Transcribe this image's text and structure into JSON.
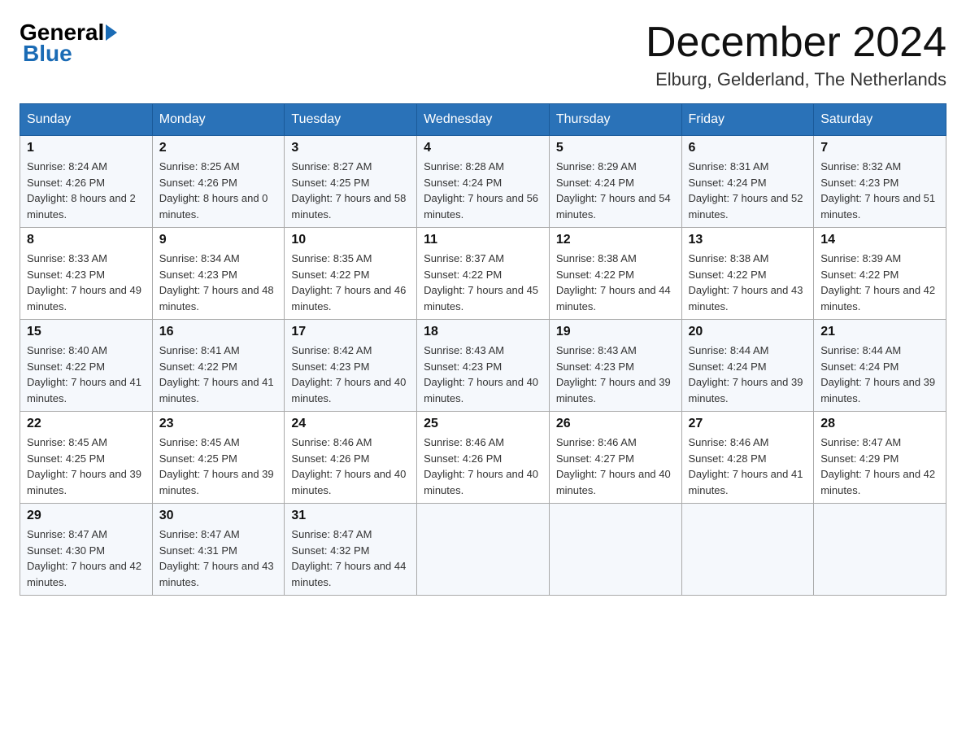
{
  "logo": {
    "general": "General",
    "blue": "Blue"
  },
  "header": {
    "month": "December 2024",
    "location": "Elburg, Gelderland, The Netherlands"
  },
  "days_of_week": [
    "Sunday",
    "Monday",
    "Tuesday",
    "Wednesday",
    "Thursday",
    "Friday",
    "Saturday"
  ],
  "weeks": [
    [
      {
        "day": "1",
        "sunrise": "8:24 AM",
        "sunset": "4:26 PM",
        "daylight": "8 hours and 2 minutes."
      },
      {
        "day": "2",
        "sunrise": "8:25 AM",
        "sunset": "4:26 PM",
        "daylight": "8 hours and 0 minutes."
      },
      {
        "day": "3",
        "sunrise": "8:27 AM",
        "sunset": "4:25 PM",
        "daylight": "7 hours and 58 minutes."
      },
      {
        "day": "4",
        "sunrise": "8:28 AM",
        "sunset": "4:24 PM",
        "daylight": "7 hours and 56 minutes."
      },
      {
        "day": "5",
        "sunrise": "8:29 AM",
        "sunset": "4:24 PM",
        "daylight": "7 hours and 54 minutes."
      },
      {
        "day": "6",
        "sunrise": "8:31 AM",
        "sunset": "4:24 PM",
        "daylight": "7 hours and 52 minutes."
      },
      {
        "day": "7",
        "sunrise": "8:32 AM",
        "sunset": "4:23 PM",
        "daylight": "7 hours and 51 minutes."
      }
    ],
    [
      {
        "day": "8",
        "sunrise": "8:33 AM",
        "sunset": "4:23 PM",
        "daylight": "7 hours and 49 minutes."
      },
      {
        "day": "9",
        "sunrise": "8:34 AM",
        "sunset": "4:23 PM",
        "daylight": "7 hours and 48 minutes."
      },
      {
        "day": "10",
        "sunrise": "8:35 AM",
        "sunset": "4:22 PM",
        "daylight": "7 hours and 46 minutes."
      },
      {
        "day": "11",
        "sunrise": "8:37 AM",
        "sunset": "4:22 PM",
        "daylight": "7 hours and 45 minutes."
      },
      {
        "day": "12",
        "sunrise": "8:38 AM",
        "sunset": "4:22 PM",
        "daylight": "7 hours and 44 minutes."
      },
      {
        "day": "13",
        "sunrise": "8:38 AM",
        "sunset": "4:22 PM",
        "daylight": "7 hours and 43 minutes."
      },
      {
        "day": "14",
        "sunrise": "8:39 AM",
        "sunset": "4:22 PM",
        "daylight": "7 hours and 42 minutes."
      }
    ],
    [
      {
        "day": "15",
        "sunrise": "8:40 AM",
        "sunset": "4:22 PM",
        "daylight": "7 hours and 41 minutes."
      },
      {
        "day": "16",
        "sunrise": "8:41 AM",
        "sunset": "4:22 PM",
        "daylight": "7 hours and 41 minutes."
      },
      {
        "day": "17",
        "sunrise": "8:42 AM",
        "sunset": "4:23 PM",
        "daylight": "7 hours and 40 minutes."
      },
      {
        "day": "18",
        "sunrise": "8:43 AM",
        "sunset": "4:23 PM",
        "daylight": "7 hours and 40 minutes."
      },
      {
        "day": "19",
        "sunrise": "8:43 AM",
        "sunset": "4:23 PM",
        "daylight": "7 hours and 39 minutes."
      },
      {
        "day": "20",
        "sunrise": "8:44 AM",
        "sunset": "4:24 PM",
        "daylight": "7 hours and 39 minutes."
      },
      {
        "day": "21",
        "sunrise": "8:44 AM",
        "sunset": "4:24 PM",
        "daylight": "7 hours and 39 minutes."
      }
    ],
    [
      {
        "day": "22",
        "sunrise": "8:45 AM",
        "sunset": "4:25 PM",
        "daylight": "7 hours and 39 minutes."
      },
      {
        "day": "23",
        "sunrise": "8:45 AM",
        "sunset": "4:25 PM",
        "daylight": "7 hours and 39 minutes."
      },
      {
        "day": "24",
        "sunrise": "8:46 AM",
        "sunset": "4:26 PM",
        "daylight": "7 hours and 40 minutes."
      },
      {
        "day": "25",
        "sunrise": "8:46 AM",
        "sunset": "4:26 PM",
        "daylight": "7 hours and 40 minutes."
      },
      {
        "day": "26",
        "sunrise": "8:46 AM",
        "sunset": "4:27 PM",
        "daylight": "7 hours and 40 minutes."
      },
      {
        "day": "27",
        "sunrise": "8:46 AM",
        "sunset": "4:28 PM",
        "daylight": "7 hours and 41 minutes."
      },
      {
        "day": "28",
        "sunrise": "8:47 AM",
        "sunset": "4:29 PM",
        "daylight": "7 hours and 42 minutes."
      }
    ],
    [
      {
        "day": "29",
        "sunrise": "8:47 AM",
        "sunset": "4:30 PM",
        "daylight": "7 hours and 42 minutes."
      },
      {
        "day": "30",
        "sunrise": "8:47 AM",
        "sunset": "4:31 PM",
        "daylight": "7 hours and 43 minutes."
      },
      {
        "day": "31",
        "sunrise": "8:47 AM",
        "sunset": "4:32 PM",
        "daylight": "7 hours and 44 minutes."
      },
      null,
      null,
      null,
      null
    ]
  ]
}
